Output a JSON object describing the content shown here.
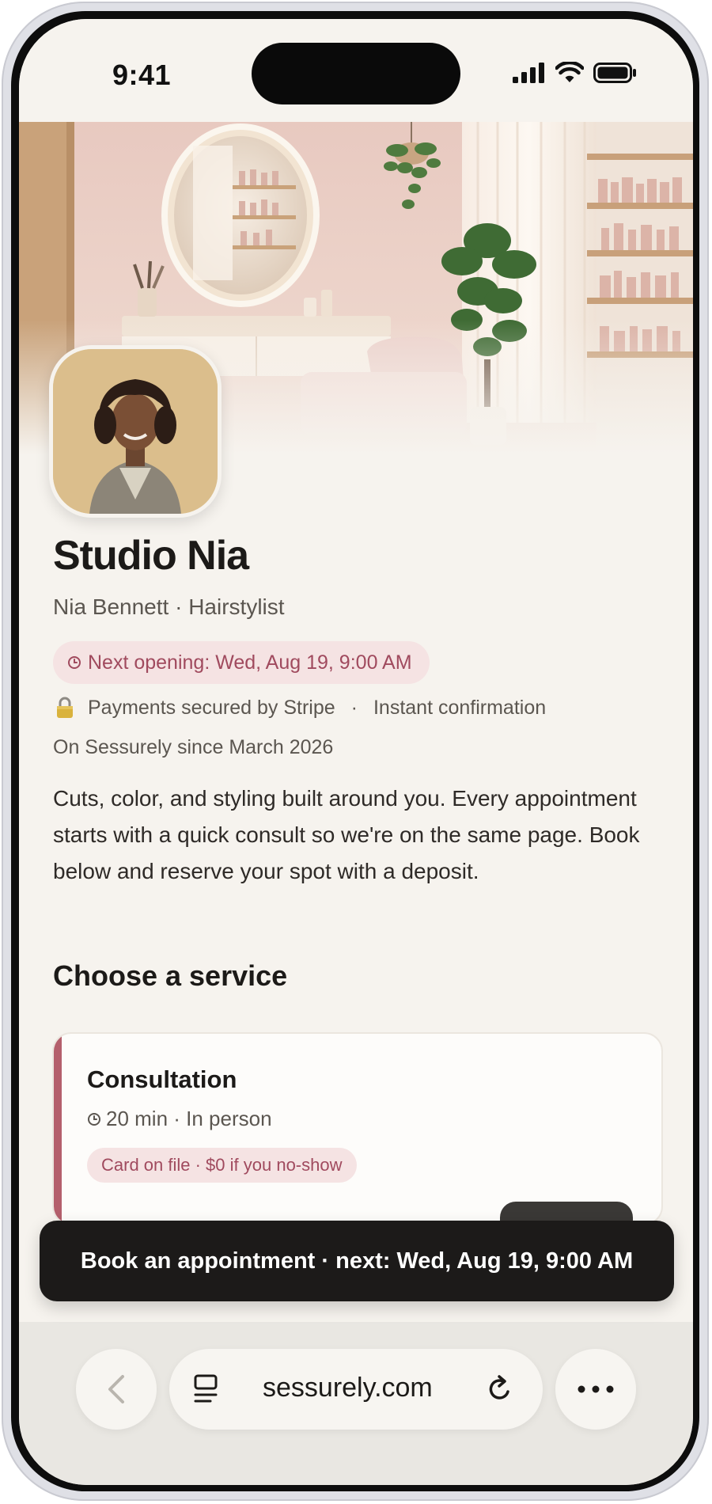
{
  "status_bar": {
    "time": "9:41"
  },
  "business": {
    "name": "Studio Nia",
    "subtitle": "Nia Bennett · Hairstylist",
    "next_opening": "Next opening: Wed, Aug 19, 9:00 AM",
    "trust_payment": "Payments secured by Stripe",
    "trust_separator": "·",
    "trust_confirmation": "Instant confirmation",
    "since": "On Sessurely since March 2026",
    "description": "Cuts, color, and styling built around you. Every appointment starts with a quick consult so we're on the same page. Book below and reserve your spot with a deposit."
  },
  "services": {
    "section_title": "Choose a service",
    "items": [
      {
        "title": "Consultation",
        "meta": "20 min · In person",
        "badge": "Card on file · $0 if you no-show"
      }
    ]
  },
  "sticky_cta": {
    "label": "Book an appointment · next: Wed, Aug 19, 9:00 AM"
  },
  "browser": {
    "url": "sessurely.com"
  },
  "colors": {
    "accent": "#b45f6c",
    "badge_bg": "#f5e3e3",
    "badge_text": "#a04a5e",
    "page_bg": "#f6f3ee",
    "cta_bg": "#1c1a19"
  }
}
